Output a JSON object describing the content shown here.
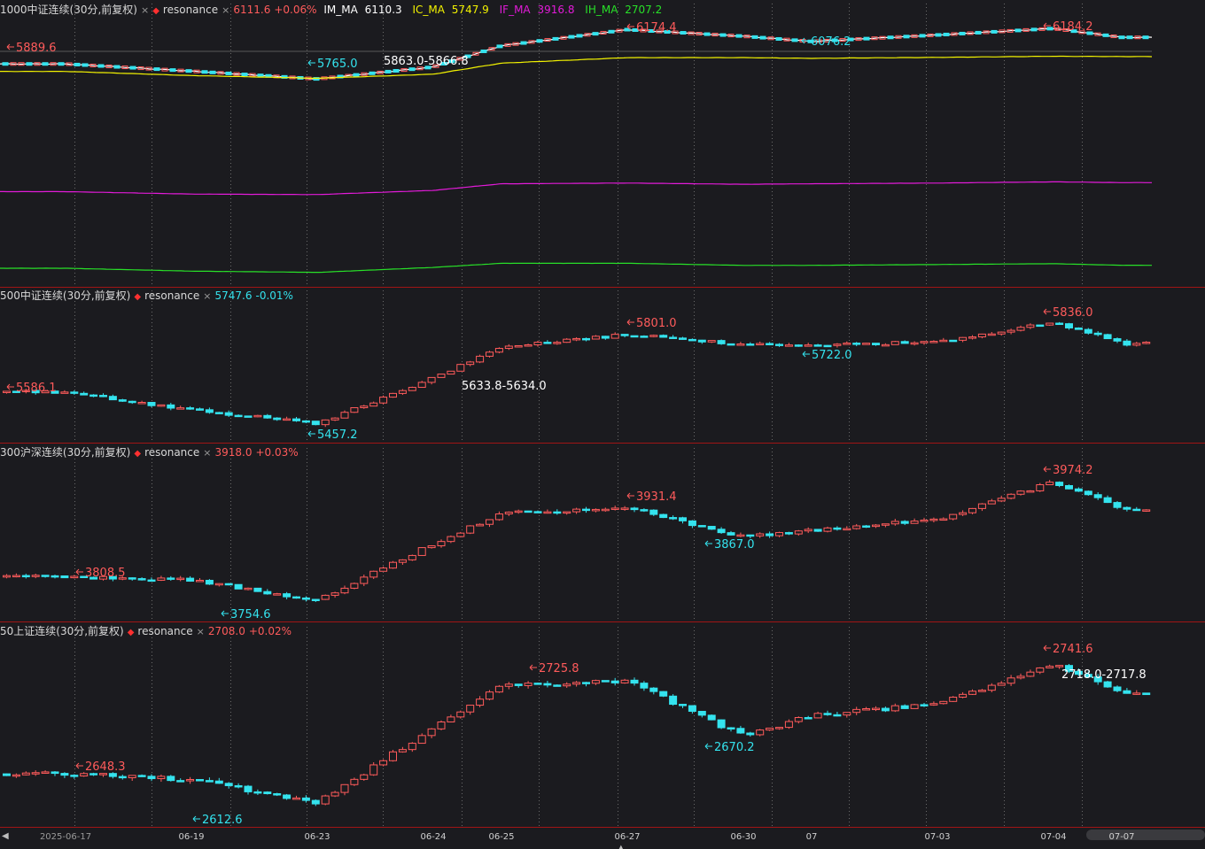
{
  "colors": {
    "background": "#1b1b1f",
    "up": "#ff5b5b",
    "down": "#34e3ee",
    "panel_border": "#a01515",
    "grid": "#6a6a6a",
    "im_ma": "#ffffff",
    "ic_ma": "#f2f200",
    "if_ma": "#e21bd8",
    "ih_ma": "#28e028"
  },
  "panels": [
    {
      "title": "1000中证连续(30分,前复权)",
      "close_icon": "×",
      "indicator_dot": "◆",
      "indicator": "resonance",
      "value": "6111.6",
      "change": "+0.06%",
      "ma_lines": [
        {
          "label": "IM_MA",
          "value": "6110.3",
          "color": "white"
        },
        {
          "label": "IC_MA",
          "value": "5747.9",
          "color": "yellow"
        },
        {
          "label": "IF_MA",
          "value": "3916.8",
          "color": "magenta"
        },
        {
          "label": "IH_MA",
          "value": "2707.2",
          "color": "green"
        }
      ]
    },
    {
      "title": "500中证连续(30分,前复权)",
      "close_icon": "×",
      "indicator_dot": "◆",
      "indicator": "resonance",
      "value": "5747.6",
      "change": "-0.01%"
    },
    {
      "title": "300沪深连续(30分,前复权)",
      "close_icon": "×",
      "indicator_dot": "◆",
      "indicator": "resonance",
      "value": "3918.0",
      "change": "+0.03%"
    },
    {
      "title": "50上证连续(30分,前复权)",
      "close_icon": "×",
      "indicator_dot": "◆",
      "indicator": "resonance",
      "value": "2708.0",
      "change": "+0.02%"
    }
  ],
  "chart_data": [
    {
      "type": "line",
      "title": "1000中证连续(30分,前复权)",
      "x": [
        "2025-06-17",
        "06-19",
        "06-23",
        "06-24",
        "06-25",
        "06-27",
        "06-30",
        "07",
        "07-03",
        "07-04",
        "07-07"
      ],
      "series": [
        {
          "name": "IM_MA",
          "values": [
            5889.6,
            5830,
            5765.0,
            5864,
            6040,
            6174.4,
            6120,
            6076.2,
            6130,
            6184.2,
            6110.3
          ]
        },
        {
          "name": "IC_MA",
          "values": [
            5640,
            5610,
            5590,
            5620,
            5700,
            5740,
            5740,
            5735,
            5742,
            5750,
            5747.9
          ]
        },
        {
          "name": "IF_MA",
          "values": [
            3880,
            3870,
            3868,
            3885,
            3912,
            3915,
            3910,
            3912,
            3915,
            3920,
            3916.8
          ]
        },
        {
          "name": "IH_MA",
          "values": [
            2700,
            2693,
            2690,
            2702,
            2712,
            2712,
            2707,
            2707,
            2709,
            2711,
            2707.2
          ]
        }
      ],
      "annotations": [
        "5889.6",
        "5765.0",
        "5863.0-5866.8",
        "6174.4",
        "6076.2",
        "6184.2"
      ],
      "legend": "top-left"
    },
    {
      "type": "candlestick",
      "title": "500中证连续(30分,前复权)",
      "x": [
        "2025-06-17",
        "06-19",
        "06-23",
        "06-24",
        "06-25",
        "06-27",
        "06-30",
        "07",
        "07-03",
        "07-04",
        "07-07"
      ],
      "anchors": [
        5575,
        5510,
        5462,
        5625,
        5735,
        5780,
        5745,
        5740,
        5755,
        5825,
        5747.6
      ],
      "annotations": [
        "5586.1",
        "5457.2",
        "5633.8-5634.0",
        "5801.0",
        "5722.0",
        "5836.0"
      ]
    },
    {
      "type": "candlestick",
      "title": "300沪深连续(30分,前复权)",
      "x": [
        "2025-06-17",
        "06-19",
        "06-23",
        "06-24",
        "06-25",
        "06-27",
        "06-30",
        "07",
        "07-03",
        "07-04",
        "07-07"
      ],
      "anchors": [
        3800,
        3795,
        3760,
        3858,
        3910,
        3920,
        3870,
        3880,
        3900,
        3965,
        3918.0
      ],
      "annotations": [
        "3808.5",
        "3754.6",
        "3931.4",
        "3867.0",
        "3974.2"
      ]
    },
    {
      "type": "candlestick",
      "title": "50上证连续(30分,前复权)",
      "x": [
        "2025-06-17",
        "06-19",
        "06-23",
        "06-24",
        "06-25",
        "06-27",
        "06-30",
        "07",
        "07-03",
        "07-04",
        "07-07"
      ],
      "anchors": [
        2640,
        2635,
        2615,
        2680,
        2715,
        2720,
        2672,
        2690,
        2700,
        2735,
        2708.0
      ],
      "annotations": [
        "2648.3",
        "2612.6",
        "2725.8",
        "2670.2",
        "2741.6",
        "2718.0-2717.8"
      ]
    }
  ],
  "xaxis": {
    "labels": [
      "2025-06-17",
      "06-19",
      "06-23",
      "06-24",
      "06-25",
      "06-27",
      "06-30",
      "07",
      "07-03",
      "07-04",
      "07-07"
    ],
    "scroll_left_icon": "◀",
    "scroll_thumb_icon": "▲"
  }
}
